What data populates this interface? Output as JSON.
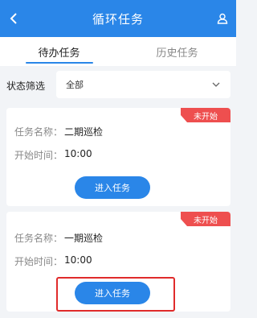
{
  "header": {
    "title": "循环任务",
    "back_icon": "chevron-left-icon",
    "user_icon": "user-icon"
  },
  "tabs": [
    {
      "label": "待办任务",
      "active": true
    },
    {
      "label": "历史任务",
      "active": false
    }
  ],
  "filter": {
    "label": "状态筛选",
    "selected": "全部",
    "icon": "chevron-down-icon"
  },
  "tasks": [
    {
      "status": "未开始",
      "name_label": "任务名称：",
      "name": "二期巡检",
      "start_label": "开始时间：",
      "start": "10:00",
      "action": "进入任务"
    },
    {
      "status": "未开始",
      "name_label": "任务名称：",
      "name": "一期巡检",
      "start_label": "开始时间：",
      "start": "10:00",
      "action": "进入任务"
    }
  ],
  "colors": {
    "primary": "#2a86e8",
    "badge": "#ee4f4f",
    "highlight": "#e02b2b",
    "background": "#f2f4f7"
  }
}
